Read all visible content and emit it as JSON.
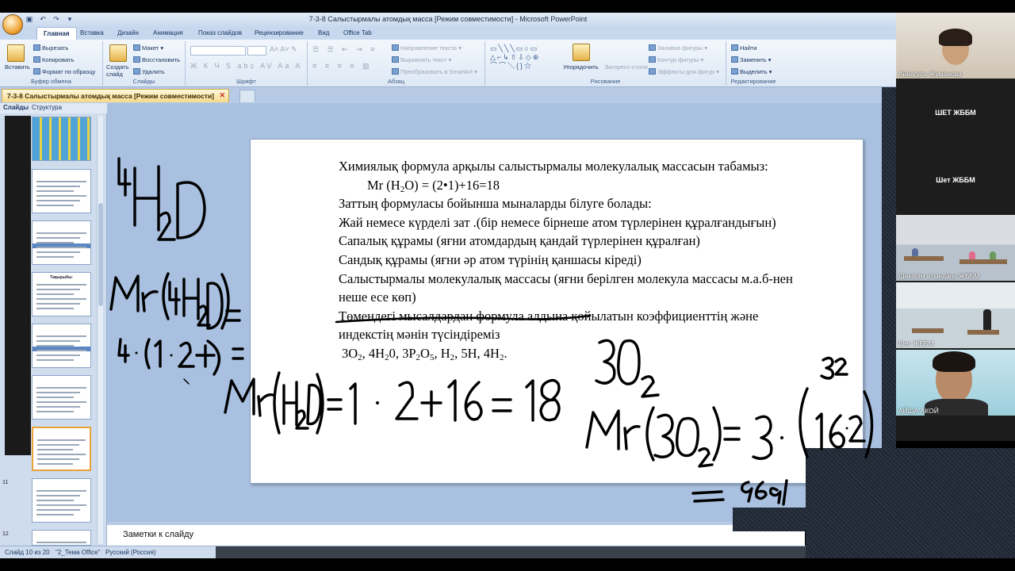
{
  "window": {
    "title": "7-3-8 Салыстырмалы  атомдық масса [Режим совместимости] - Microsoft PowerPoint"
  },
  "ribbon_tabs": [
    "Главная",
    "Вставка",
    "Дизайн",
    "Анимация",
    "Показ слайдов",
    "Рецензирование",
    "Вид",
    "Office Tab"
  ],
  "ribbon": {
    "clipboard": {
      "paste": "Вставить",
      "cut": "Вырезать",
      "copy": "Копировать",
      "format_painter": "Формат по образцу",
      "label": "Буфер обмена"
    },
    "slides": {
      "new_slide": "Создать слайд",
      "layout": "Макет",
      "reset": "Восстановить",
      "delete": "Удалить",
      "label": "Слайды"
    },
    "font": {
      "label": "Шрифт"
    },
    "paragraph": {
      "text_direction": "Направление текста",
      "align_text": "Выровнять текст",
      "smartart": "Преобразовать в SmartArt",
      "label": "Абзац"
    },
    "drawing": {
      "arrange": "Упорядочить",
      "quick_styles": "Экспресс-стили",
      "shape_fill": "Заливка фигуры",
      "shape_outline": "Контур фигуры",
      "shape_effects": "Эффекты для фигур",
      "label": "Рисование"
    },
    "editing": {
      "find": "Найти",
      "replace": "Заменить",
      "select": "Выделить",
      "label": "Редактирование"
    }
  },
  "doc_tab": "7-3-8 Салыстырмалы  атомдық масса [Режим совместимости]",
  "panel_tabs": [
    "Слайды",
    "Структура"
  ],
  "thumbnails": [
    {
      "num": "",
      "title": ""
    },
    {
      "num": "",
      "title": ""
    },
    {
      "num": "",
      "title": ""
    },
    {
      "num": "",
      "title": "Тақырыбы:"
    },
    {
      "num": "",
      "title": ""
    },
    {
      "num": "",
      "title": ""
    },
    {
      "num": "",
      "title": ""
    },
    {
      "num": "11",
      "title": ""
    },
    {
      "num": "12",
      "title": ""
    }
  ],
  "slide": {
    "line1": "Химиялық формула арқылы салыстырмалы молекулалық массасын табамыз:",
    "line2_pre": "Mr (H",
    "line2_sub": "2",
    "line2_post": "O) = (2•1)+16=18",
    "line3": "Заттың формуласы бойынша мыналарды білуге болады:",
    "line4": "Жай немесе күрделі зат .(бір немесе бірнеше атом түрлерінен құралғандығын)",
    "line5": "Сапалық құрамы  (яғни атомдардың қандай түрлерінен құралған)",
    "line6": "Сандық құрамы   (яғни әр атом түрінің қаншасы кіреді)",
    "line7": "Салыстырмалы молекулалық массасы (яғни берілген молекула массасы м.а.б-нен",
    "line8": "неше есе көп)",
    "line9": "Төмендегі мысалдардан формула алдына қойылатын коэффициенттің және",
    "line10": "индекстің мәнін түсіндіреміз",
    "examples": [
      {
        "a": "3O",
        "s": "2",
        "b": ", "
      },
      {
        "a": "4H",
        "s": "2",
        "b": "0, "
      },
      {
        "a": "3P",
        "s": "2",
        "b": ""
      },
      {
        "a": "O",
        "s": "5",
        "b": ", "
      },
      {
        "a": "H",
        "s": "2",
        "b": ", 5H, "
      },
      {
        "a": "4H",
        "s": "2",
        "b": "."
      }
    ]
  },
  "notes_placeholder": "Заметки к слайду",
  "status": {
    "slide": "Слайд 10 из 20",
    "theme": "\"2_Тема Office\"",
    "lang": "Русский (Россия)"
  },
  "participants": [
    {
      "name": "Айнагуль Жуманова",
      "type": "video"
    },
    {
      "name": "ШЕТ ЖББМ",
      "type": "label"
    },
    {
      "name": "Шет ЖББМ",
      "type": "label"
    },
    {
      "name": "Шәкәрім атындағы ЖББМ",
      "type": "video"
    },
    {
      "name": "Шет ЖББМ",
      "type": "video"
    },
    {
      "name": "АЙША АКОЙ",
      "type": "video"
    }
  ],
  "colors": {
    "ribbon_bg": "#dde8f5",
    "stage_bg": "#a9c0e0",
    "accent_tab": "#f6d98a"
  }
}
